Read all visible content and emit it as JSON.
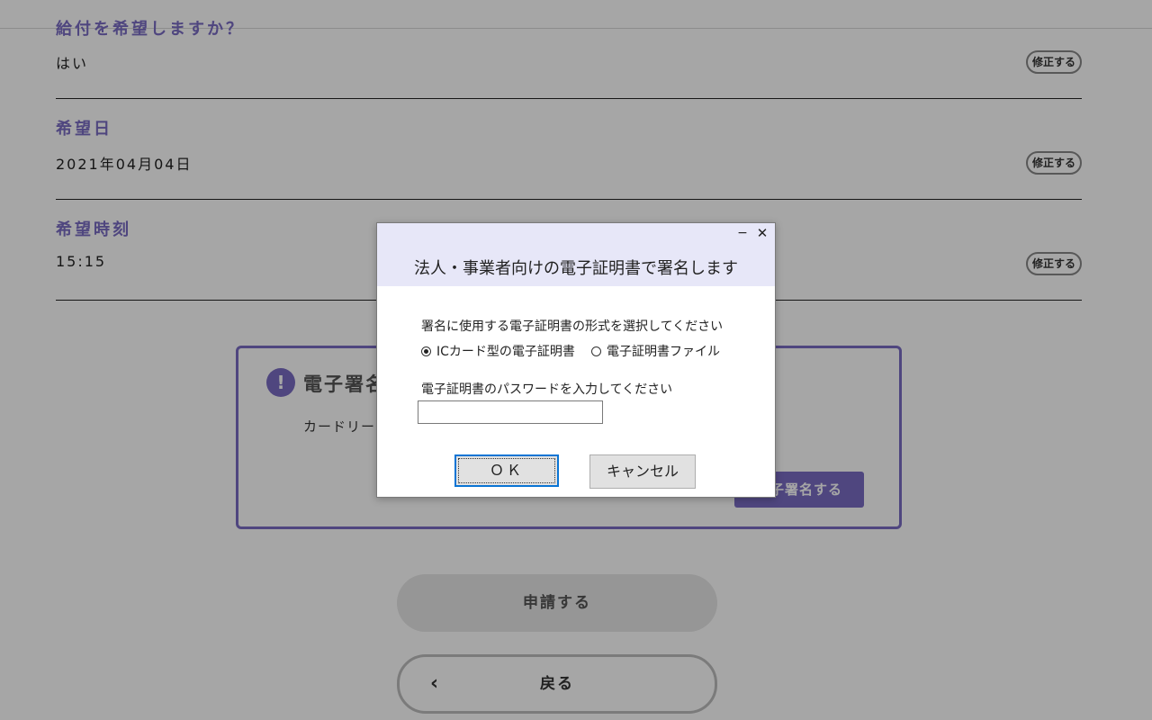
{
  "form": {
    "partial_heading": "給付を希望しますか？",
    "rows": [
      {
        "label": "",
        "value": "はい",
        "edit": "修正する"
      },
      {
        "label": "希望日",
        "value": "2021年04月04日",
        "edit": "修正する"
      },
      {
        "label": "希望時刻",
        "value": "15:15",
        "edit": "修正する"
      }
    ]
  },
  "signature": {
    "icon": "exclamation-icon",
    "title": "電子署名",
    "text": "カードリーダ",
    "button_label": "電子署名する"
  },
  "actions": {
    "apply_label": "申請する",
    "back_label": "戻る",
    "back_icon": "chevron-left-icon"
  },
  "dialog": {
    "title": "法人・事業者向けの電子証明書で署名します",
    "minimize": "−",
    "close": "✕",
    "select_label": "署名に使用する電子証明書の形式を選択してください",
    "options": [
      {
        "label": "ICカード型の電子証明書",
        "selected": true
      },
      {
        "label": "電子証明書ファイル",
        "selected": false
      }
    ],
    "password_label": "電子証明書のパスワードを入力してください",
    "password_value": "",
    "ok_label": "ＯＫ",
    "cancel_label": "キャンセル"
  },
  "colors": {
    "accent": "#7a6cc4",
    "dialog_header": "#e7e7f8",
    "focus_border": "#0a74d4"
  }
}
